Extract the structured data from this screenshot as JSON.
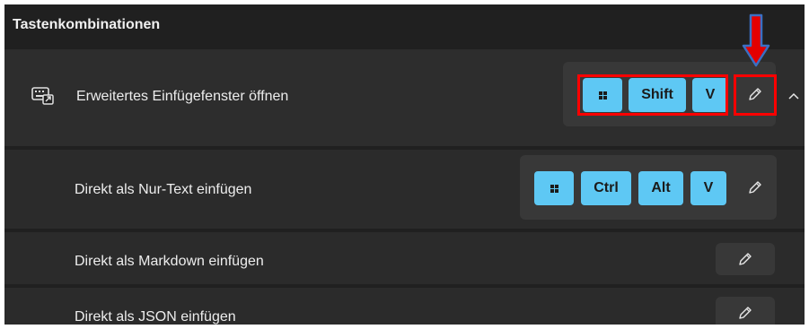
{
  "section": {
    "title": "Tastenkombinationen"
  },
  "rows": [
    {
      "label": "Erweitertes Einfügefenster öffnen",
      "keys": [
        "win-icon",
        "Shift",
        "V"
      ]
    },
    {
      "label": "Direkt als Nur-Text einfügen",
      "keys": [
        "win-icon",
        "Ctrl",
        "Alt",
        "V"
      ]
    },
    {
      "label": "Direkt als Markdown einfügen",
      "keys": []
    },
    {
      "label": "Direkt als JSON einfügen",
      "keys": []
    }
  ],
  "colors": {
    "background": "#202020",
    "card": "#2b2b2b",
    "key_fill": "#5ec8f4",
    "annotation_red": "#ff0000",
    "annotation_arrow_outline": "#3a6fc4"
  },
  "icons": {
    "row_icon": "keyboard-shortcut-icon",
    "edit": "pencil-icon",
    "collapse": "chevron-up-icon",
    "windows_key": "windows-logo-icon",
    "annotation": "down-arrow-icon"
  }
}
